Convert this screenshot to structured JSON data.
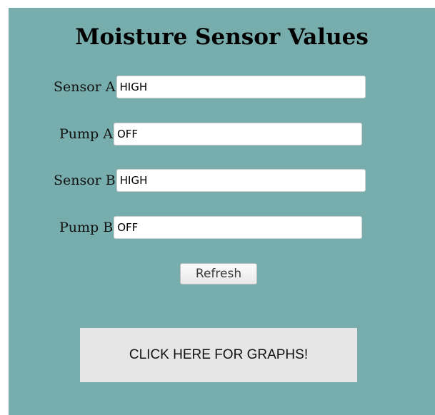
{
  "page": {
    "title": "Moisture Sensor Values"
  },
  "fields": [
    {
      "label": "Sensor A",
      "value": "HIGH"
    },
    {
      "label": "Pump A",
      "value": "OFF"
    },
    {
      "label": "Sensor B",
      "value": "HIGH"
    },
    {
      "label": "Pump B",
      "value": "OFF"
    }
  ],
  "actions": {
    "refresh_label": "Refresh",
    "graphs_label": "CLICK HERE FOR GRAPHS!"
  },
  "colors": {
    "panel_background": "#77aead",
    "graphs_button_background": "#e6e6e6"
  }
}
